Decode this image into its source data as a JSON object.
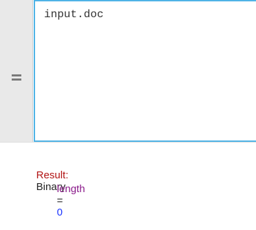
{
  "editor": {
    "input_text": "input.doc"
  },
  "result": {
    "label": "Result:",
    "value": "Binary",
    "property_name": "length",
    "equals": "=",
    "property_value": "0"
  },
  "colors": {
    "accent_border": "#4fb3e6",
    "result_label": "#b11212",
    "property_name": "#8a1a8a",
    "property_value": "#1a33ff"
  }
}
